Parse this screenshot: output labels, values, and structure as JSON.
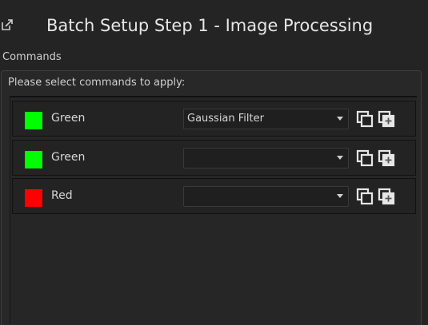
{
  "window": {
    "title": "Batch Setup Step 1 - Image Processing",
    "icon": "external-link-icon"
  },
  "commands_group": {
    "label": "Commands",
    "instruction": "Please select commands to apply:"
  },
  "rows": [
    {
      "channel": "Green",
      "color": "#00ff00",
      "command": "Gaussian Filter"
    },
    {
      "channel": "Green",
      "color": "#00ff00",
      "command": ""
    },
    {
      "channel": "Red",
      "color": "#ff0000",
      "command": ""
    }
  ],
  "icons": {
    "copy": "copy-icon",
    "duplicate": "add-copy-icon",
    "dropdown": "chevron-down-icon"
  }
}
